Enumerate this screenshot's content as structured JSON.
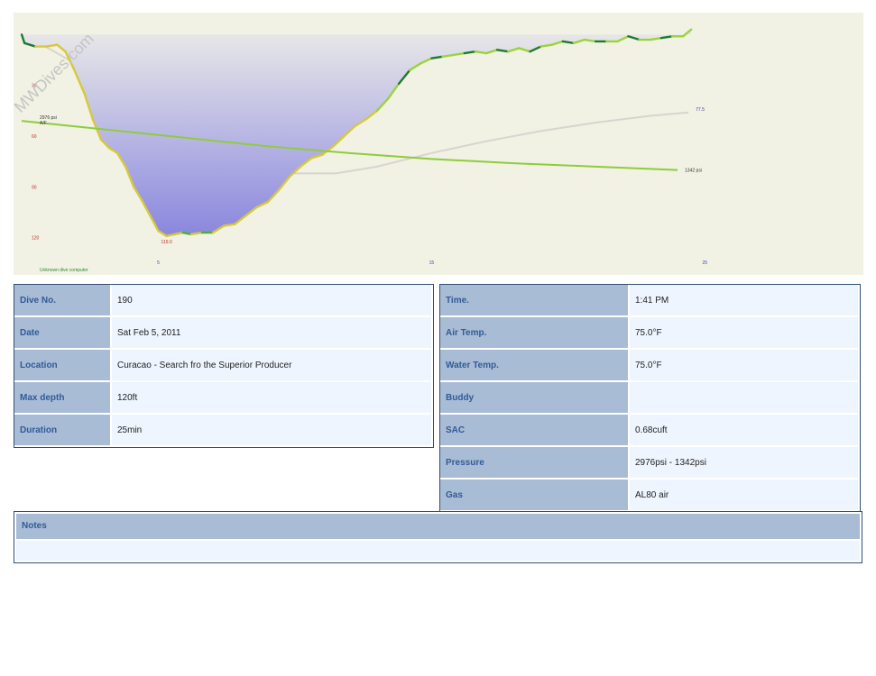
{
  "watermark": "MWDives.com",
  "chart_data": {
    "type": "area",
    "computer_label": "Unknown dive computer",
    "x_ticks": [
      5,
      15,
      25
    ],
    "xlim": [
      -0.3,
      30.8
    ],
    "y_ticks": [
      30,
      60,
      90,
      120
    ],
    "ylim": [
      -13,
      142
    ],
    "inverted_y": true,
    "max_depth_label": "119.0",
    "max_depth_point": {
      "x": 5.3,
      "y": 119
    },
    "series": [
      {
        "name": "Depth",
        "unit": "ft",
        "x": [
          0,
          0.1,
          0.5,
          0.9,
          1.3,
          1.6,
          1.9,
          2.3,
          2.6,
          2.9,
          3.2,
          3.5,
          3.8,
          4.1,
          4.4,
          4.7,
          5.0,
          5.3,
          5.6,
          5.9,
          6.2,
          6.6,
          7.0,
          7.4,
          7.8,
          8.2,
          8.6,
          9.0,
          9.4,
          9.8,
          10.2,
          10.6,
          11.0,
          11.4,
          11.8,
          12.2,
          12.6,
          13.0,
          13.4,
          13.8,
          14.2,
          14.6,
          15.0,
          15.4,
          15.8,
          16.2,
          16.6,
          17.0,
          17.4,
          17.8,
          18.2,
          18.6,
          19.0,
          19.4,
          19.8,
          20.2,
          20.6,
          21.0,
          21.4,
          21.8,
          22.2,
          22.6,
          23.0,
          23.4,
          23.8,
          24.2,
          24.5
        ],
        "y": [
          0,
          5,
          7,
          7,
          6,
          10,
          20,
          35,
          50,
          62,
          67,
          70,
          78,
          90,
          98,
          107,
          116,
          119,
          118,
          117,
          118,
          117,
          117,
          113,
          112,
          107,
          102,
          99,
          92,
          84,
          78,
          73,
          71,
          66,
          60,
          54,
          50,
          45,
          38,
          29,
          21,
          17,
          14,
          13,
          12,
          11,
          10,
          11,
          9,
          10,
          8,
          10,
          7,
          6,
          4,
          5,
          3,
          4,
          4,
          4,
          1,
          3,
          3,
          2,
          1,
          1,
          -3
        ]
      },
      {
        "name": "Tank pressure",
        "unit": "psi",
        "start_label": "2976 psi",
        "end_label": "1342 psi",
        "x": [
          0,
          3,
          6,
          9,
          12,
          15,
          18,
          21,
          24
        ],
        "y": [
          51,
          56,
          61,
          66,
          70,
          73.5,
          76,
          78,
          80
        ]
      },
      {
        "name": "Temperature",
        "start_label": "A/F",
        "end_label": "77.5",
        "x": [
          0.2,
          2.5,
          4.5,
          6.5,
          8.5,
          10.0,
          11.5,
          13.0,
          15.0,
          17.0,
          19.0,
          21.0,
          23.0,
          24.4
        ],
        "y": [
          1,
          22,
          44,
          62,
          75,
          82,
          82,
          78,
          70,
          63,
          57,
          52,
          48,
          46
        ]
      }
    ],
    "colors": {
      "plot_bg": "#f1f1e4",
      "fill_top": "#e9e9e9",
      "fill_bottom": "#8a87de",
      "descent": "#d6c93a",
      "bottom_phase": "#4caf3a",
      "ascent": "#9ad43a",
      "ascent_dark": "#1f7a2e",
      "pressure": "#8fcc3a",
      "temperature": "#d6d6cf",
      "depth_tick": "#c03030",
      "x_tick": "#2a4cc0"
    }
  },
  "left_table": [
    {
      "label": "Dive No.",
      "value": "190"
    },
    {
      "label": "Date",
      "value": "Sat Feb 5, 2011"
    },
    {
      "label": "Location",
      "value": "Curacao - Search fro the Superior Producer"
    },
    {
      "label": "Max depth",
      "value": "120ft"
    },
    {
      "label": "Duration",
      "value": "25min"
    }
  ],
  "right_table": [
    {
      "label": "Time.",
      "value": "1:41 PM"
    },
    {
      "label": "Air Temp.",
      "value": "75.0°F"
    },
    {
      "label": "Water Temp.",
      "value": "75.0°F"
    },
    {
      "label": "Buddy",
      "value": ""
    },
    {
      "label": "SAC",
      "value": "0.68cuft"
    },
    {
      "label": "Pressure",
      "value": "2976psi - 1342psi"
    },
    {
      "label": "Gas",
      "value": "AL80 air"
    }
  ],
  "notes": {
    "label": "Notes",
    "value": ""
  }
}
